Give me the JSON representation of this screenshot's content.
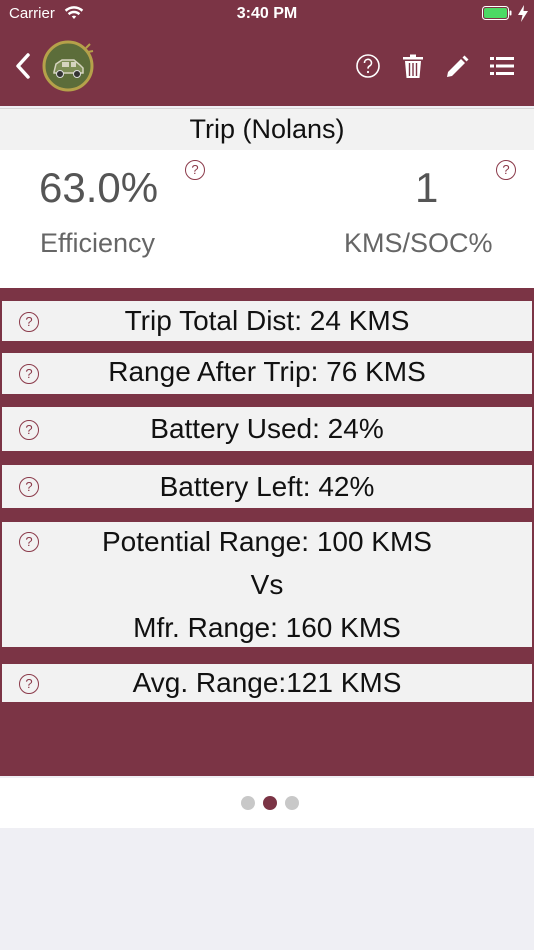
{
  "status_bar": {
    "carrier": "Carrier",
    "time": "3:40 PM"
  },
  "nav": {
    "icons": [
      "back-chevron-icon",
      "app-logo-car-icon",
      "help-icon",
      "trash-icon",
      "edit-pencil-icon",
      "list-icon"
    ]
  },
  "title": "Trip (Nolans)",
  "summary": {
    "efficiency_value": "63.0%",
    "efficiency_label": "Efficiency",
    "kms_soc_value": "1",
    "kms_soc_label": "KMS/SOC%"
  },
  "help_glyph": "?",
  "stats": {
    "trip_total_dist": "Trip Total Dist: 24 KMS",
    "range_after_trip": "Range After Trip: 76 KMS",
    "battery_used": "Battery Used: 24%",
    "battery_left": "Battery Left: 42%",
    "potential_range": "Potential Range: 100 KMS",
    "vs": "Vs",
    "mfr_range": "Mfr. Range: 160 KMS",
    "avg_range": "Avg. Range:121 KMS"
  },
  "pager": {
    "pages": 3,
    "current": 2
  },
  "colors": {
    "accent": "#7b3445",
    "help": "#8b3a4a",
    "dot_inactive": "#c8c8c8"
  }
}
